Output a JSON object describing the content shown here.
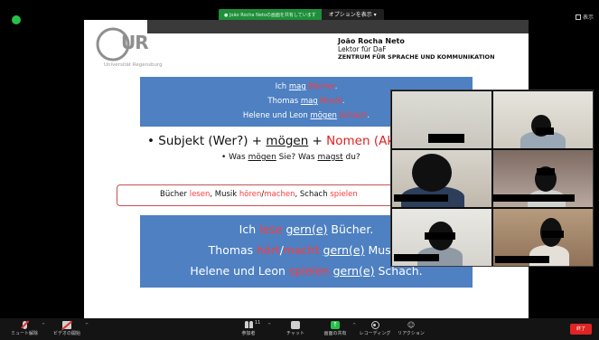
{
  "status": {
    "shield_icon": "green-shield"
  },
  "share_banner": {
    "status_text": "● João Rocha Netoの画面を共有しています",
    "options_label": "オプションを表示 ▾"
  },
  "view_button": {
    "label": "表示"
  },
  "slide": {
    "logo_text": "UR",
    "university": "Universität Regensburg",
    "lecturer_name": "João Rocha Neto",
    "lecturer_role": "Lektor für DaF",
    "department": "ZENTRUM FÜR SPRACHE UND KOMMUNIKATION",
    "examples": [
      {
        "subject": "Ich ",
        "verb": "mag",
        "object": "Bücher",
        "end": "."
      },
      {
        "subject": "Thomas ",
        "verb": "mag",
        "object": "Musik",
        "end": "."
      },
      {
        "subject": "Helene und Leon ",
        "verb": "mögen",
        "object": "Schach",
        "end": "."
      }
    ],
    "rule": {
      "prefix": "• Subjekt (Wer?) + ",
      "verb": "mögen",
      "plus": " + ",
      "noun": "Nomen (Akk.)"
    },
    "question": {
      "prefix": "• Was ",
      "verb1": "mögen",
      "middle": " Sie? Was ",
      "verb2": "magst",
      "end": " du?"
    },
    "activities": {
      "p1": "Bücher ",
      "v1": "lesen",
      "p2": ", Musik ",
      "v2": "hören",
      "sep": "/",
      "v3": "machen",
      "p3": ", Schach ",
      "v4": "spielen"
    },
    "sentences": [
      {
        "pre": "Ich ",
        "verb": "lese",
        "mid": " ",
        "gern": "gern(e)",
        "post": " Bücher."
      },
      {
        "pre": "Thomas ",
        "verb": "hört",
        "slash": "/",
        "verb2": "macht",
        "mid": " ",
        "gern": "gern(e)",
        "post": " Musik."
      },
      {
        "pre": "Helene und Leon ",
        "verb": "spielen",
        "mid": " ",
        "gern": "gern(e)",
        "post": " Schach."
      }
    ]
  },
  "toolbar": {
    "mute_label": "ミュート解除",
    "video_label": "ビデオの開始",
    "participants_count": "11",
    "participants_label": "参加者",
    "chat_label": "チャット",
    "share_label": "画面の共有",
    "record_label": "レコーディング",
    "reactions_label": "リアクション",
    "end_label": "終了"
  },
  "colors": {
    "slide_blue": "#4e80c2",
    "highlight_red": "#ff3b3b",
    "share_green": "#1f8f3a",
    "end_red": "#e02424"
  }
}
